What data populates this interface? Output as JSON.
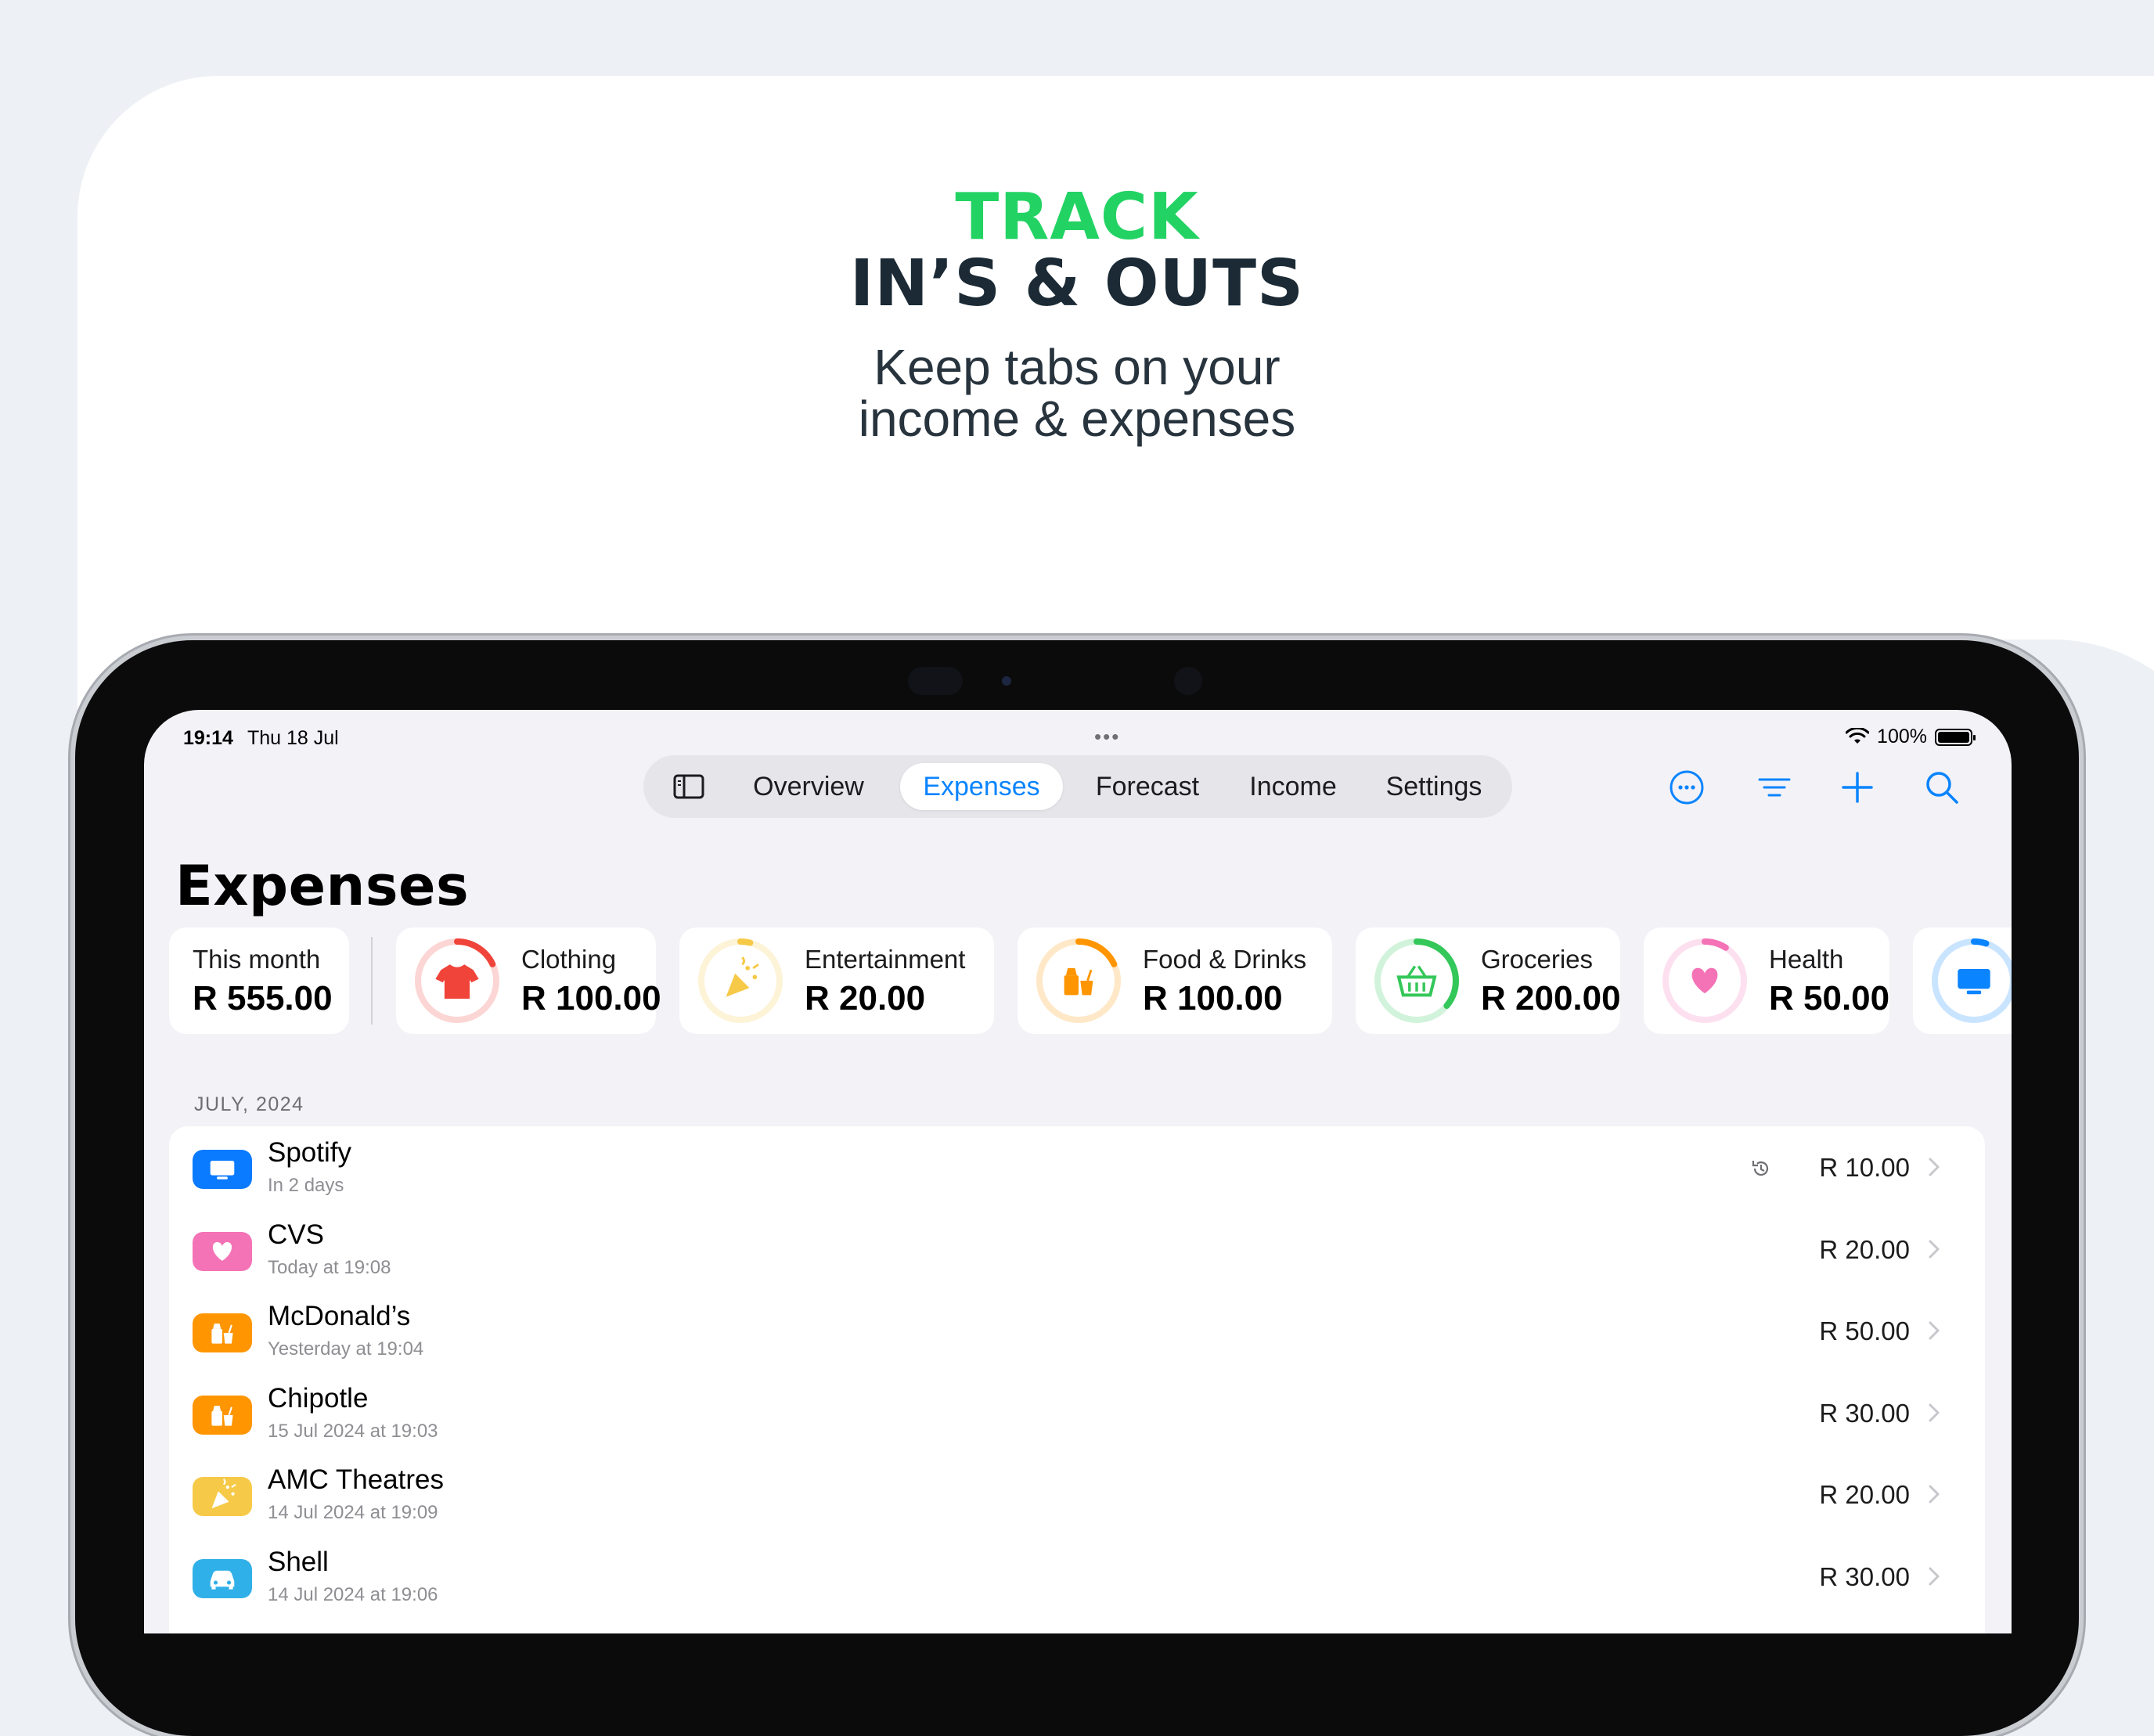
{
  "headline": {
    "line1": "TRACK",
    "line2": "IN’S & OUTS"
  },
  "subheadline": {
    "line1": "Keep tabs on your",
    "line2": "income & expenses"
  },
  "status_bar": {
    "time": "19:14",
    "date": "Thu 18 Jul",
    "battery": "100%"
  },
  "nav": {
    "tabs": [
      {
        "label": "Overview"
      },
      {
        "label": "Expenses"
      },
      {
        "label": "Forecast"
      },
      {
        "label": "Income"
      },
      {
        "label": "Settings"
      }
    ],
    "active_tab": "Expenses",
    "toolbar_icons": [
      "more-icon",
      "filter-icon",
      "add-icon",
      "search-icon"
    ]
  },
  "page": {
    "title": "Expenses"
  },
  "summary": {
    "label": "This month",
    "amount": "R 555.00"
  },
  "categories": [
    {
      "label": "Clothing",
      "amount": "R 100.00",
      "color": "#f0443a",
      "icon": "shirt-icon",
      "progress": 0.18
    },
    {
      "label": "Entertainment",
      "amount": "R 20.00",
      "color": "#f7c948",
      "icon": "party-popper-icon",
      "progress": 0.04
    },
    {
      "label": "Food & Drinks",
      "amount": "R 100.00",
      "color": "#ff9500",
      "icon": "food-drink-icon",
      "progress": 0.18
    },
    {
      "label": "Groceries",
      "amount": "R 200.00",
      "color": "#34c759",
      "icon": "basket-icon",
      "progress": 0.36
    },
    {
      "label": "Health",
      "amount": "R 50.00",
      "color": "#f472b6",
      "icon": "heart-icon",
      "progress": 0.09
    },
    {
      "label": "",
      "amount": "",
      "color": "#0a84ff",
      "icon": "tv-icon",
      "progress": 0.05
    }
  ],
  "section": {
    "header": "JULY, 2024"
  },
  "transactions": [
    {
      "name": "Spotify",
      "date": "In 2 days",
      "amount": "R 10.00",
      "color": "#0a7aff",
      "icon": "tv-icon",
      "recurring": true
    },
    {
      "name": "CVS",
      "date": "Today at 19:08",
      "amount": "R 20.00",
      "color": "#f472b6",
      "icon": "heart-icon",
      "recurring": false
    },
    {
      "name": "McDonald’s",
      "date": "Yesterday at 19:04",
      "amount": "R 50.00",
      "color": "#ff9500",
      "icon": "food-drink-icon",
      "recurring": false
    },
    {
      "name": "Chipotle",
      "date": "15 Jul 2024 at 19:03",
      "amount": "R 30.00",
      "color": "#ff9500",
      "icon": "food-drink-icon",
      "recurring": false
    },
    {
      "name": "AMC Theatres",
      "date": "14 Jul 2024 at 19:09",
      "amount": "R 20.00",
      "color": "#f7c948",
      "icon": "party-popper-icon",
      "recurring": false
    },
    {
      "name": "Shell",
      "date": "14 Jul 2024 at 19:06",
      "amount": "R 30.00",
      "color": "#30b0e8",
      "icon": "car-icon",
      "recurring": false
    }
  ]
}
